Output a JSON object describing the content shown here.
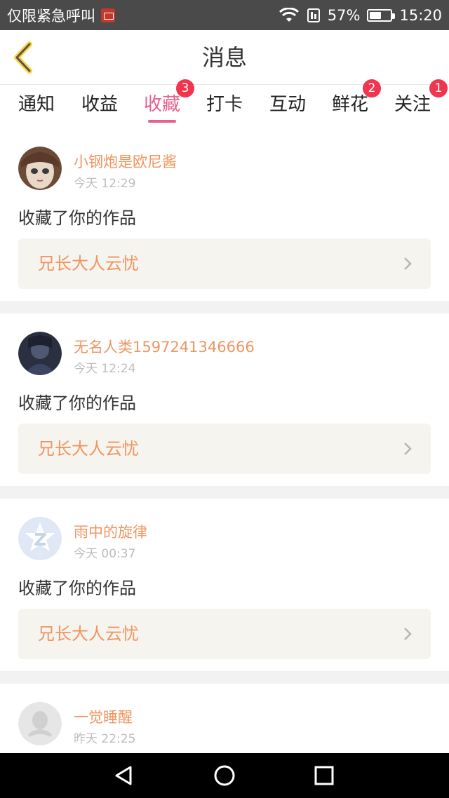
{
  "status_bar": {
    "carrier": "仅限紧急呼叫",
    "battery_percent": "57%",
    "battery_level": 0.57,
    "time": "15:20"
  },
  "header": {
    "title": "消息",
    "back_icon": "chevron-left-icon"
  },
  "tabs": [
    {
      "label": "通知",
      "badge": ""
    },
    {
      "label": "收益",
      "badge": ""
    },
    {
      "label": "收藏",
      "badge": "3",
      "active": true
    },
    {
      "label": "打卡",
      "badge": ""
    },
    {
      "label": "互动",
      "badge": ""
    },
    {
      "label": "鲜花",
      "badge": "2"
    },
    {
      "label": "关注",
      "badge": "1"
    }
  ],
  "items": [
    {
      "user": "小钢炮是欧尼酱",
      "time": "今天 12:29",
      "action": "收藏了你的作品",
      "work": "兄长大人云忧"
    },
    {
      "user": "无名人类1597241346666",
      "time": "今天 12:24",
      "action": "收藏了你的作品",
      "work": "兄长大人云忧"
    },
    {
      "user": "雨中的旋律",
      "time": "今天 00:37",
      "action": "收藏了你的作品",
      "work": "兄长大人云忧"
    },
    {
      "user": "一觉睡醒",
      "time": "昨天 22:25",
      "action": "",
      "work": ""
    }
  ],
  "colors": {
    "accent": "#e8608d",
    "badge": "#f0364f",
    "username": "#f09560",
    "work_bg": "#f5f4ee"
  }
}
